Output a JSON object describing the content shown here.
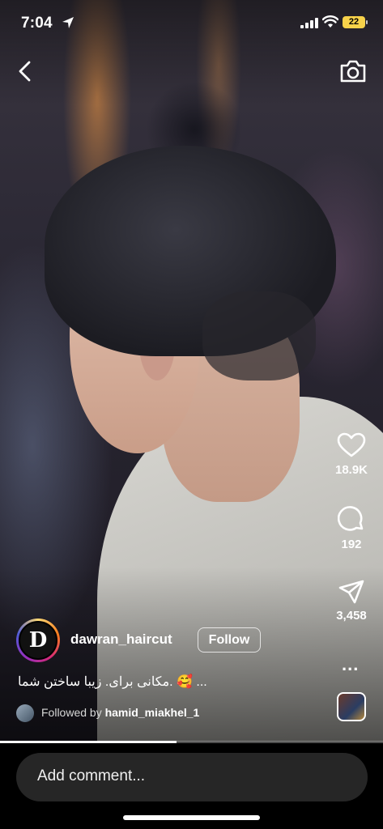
{
  "status_bar": {
    "time": "7:04",
    "battery": "22",
    "icons": [
      "location-arrow-icon",
      "cellular-signal-icon",
      "wifi-icon",
      "battery-icon"
    ]
  },
  "header": {
    "back_icon": "chevron-left-icon",
    "camera_icon": "camera-icon"
  },
  "actions": {
    "likes": "18.9K",
    "comments": "192",
    "shares": "3,458",
    "more": "..."
  },
  "post": {
    "username": "dawran_haircut",
    "avatar_letter": "D",
    "follow_label": "Follow",
    "caption": "مکانی برای. زیبا ساختن  شما. 🥰 ...",
    "followed_by_prefix": "Followed by",
    "followed_by_user": "hamid_miakhel_1"
  },
  "playback": {
    "progress_fraction": 0.46
  },
  "comment": {
    "placeholder": "Add comment..."
  },
  "colors": {
    "battery": "#f7d24a",
    "comment_bg": "#262626",
    "background": "#000000"
  }
}
